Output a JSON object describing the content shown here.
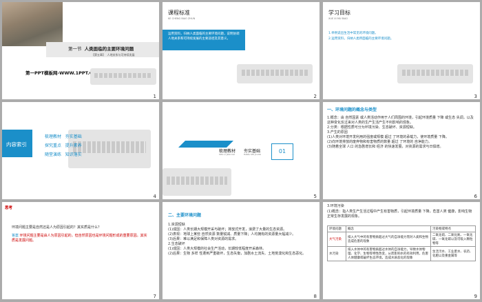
{
  "slides": [
    {
      "num": "1",
      "section": "第一节",
      "title": "人类面临的主要环境问题",
      "sub_tag": "【第五章】",
      "sub_text": "人地关系与可持续发展",
      "url": "第一PPT模板网-WWW.1PPT.COM"
    },
    {
      "num": "2",
      "title": "课程标准",
      "subtitle": "KE CHENG BIAO ZHUN",
      "body": "运用资料，归纳人类面临的主要环境问题，说明协调人地关系和可持续发展的主要途径及其意义。"
    },
    {
      "num": "3",
      "title": "学习目标",
      "subtitle": "XUE XI MU BIAO",
      "items": [
        "1.举例说出生活中常见的环境问题。",
        "2.运用资料，归纳人类所面临的主要环境问题。"
      ]
    },
    {
      "num": "4",
      "index_title": "内容索引",
      "grid": [
        "梳理教材",
        "夯实基础",
        "探究重点",
        "提升素养",
        "随堂演练",
        "知识落实"
      ]
    },
    {
      "num": "5",
      "t1": "梳理教材",
      "t1p": "SHU LI JIAO CAI",
      "t2": "夯实基础",
      "t2p": "HANG SHI JI CHU",
      "badge": "01"
    },
    {
      "num": "6",
      "heading": "一、环境问题的概念与类型",
      "lines": [
        "1.概念：由 自然因素 或人类活动作用于人们周围的环境，引起环境质量 下降 或生态 失调，以及这种变化反过来对人类的生产生活产生不利影响的现象。",
        "2.分类：根据性质可分为环境污染、生态破坏、资源短缺。",
        "3.产生的原因",
        "(1)人类对环境开发利用的强度或规模 超过 了环境的承载力，使环境质量 下降。",
        "(2)向环境排放的废弃物和有害物质的数量 超过 了环境的 自净能力。",
        "(3)随着全球 人口 的急剧增长和 经济 的快速发展，对资源的需求与日俱增。"
      ]
    },
    {
      "num": "7",
      "tag": "思考",
      "question": "环境问题主要是自然还是人为原因引起的？其实质是什么？",
      "answer_label": "答案",
      "answer": "环境问题主要是由人为原因引起的，但自然原因也是环境问题形成的重要原因。其实质是发展问题。"
    },
    {
      "num": "8",
      "heading": "二、主要环境问题",
      "lines": [
        "1.资源短缺",
        "(1)成因：人类长期大规模开采与破坏；排放式开发，浪费了大量的生态资源。",
        "(2)表现：地球上某些 自然资源 数量锐减、质量下降；人均拥有的资源量大幅减少。",
        "(3)后果：难以满足和保障人类对资源的需求。",
        "2.生态破坏",
        "(1)成因：人类大规模的社会生产活动，长期较低程度开采森林。",
        "(2)后果：生物 多样 性遭到严重破坏，生态失衡，加剧水土流失、土地荒漠化和生态恶化。"
      ]
    },
    {
      "num": "9",
      "intro": "3.环境污染",
      "concept": "(1)概念：指人类生产生活过程中产生有害物质，引起环境质量 下降，危害人类 健康，影响生物正常生存发展的现象。",
      "headers": [
        "环境问题",
        "概念",
        "污染物或特点"
      ],
      "rows": [
        [
          "大气污染",
          "排入大气中的有害物质超过大气的自净能力而对人类和生物造成危害的现象",
          "二氧化硫、二氧化氮、一氧化碳、一氧化碳以及可吸入颗粒物等"
        ],
        [
          "水污染",
          "排入水体中的有害物质超过水体的自净能力，导致水体物理、化学、生物等特性改变，从而影响水的有效利用，危害人体健康或破坏生态环境，造成水质恶化的现象",
          "生活污水、工业废水、农药、化肥以及重金属等"
        ]
      ]
    }
  ]
}
